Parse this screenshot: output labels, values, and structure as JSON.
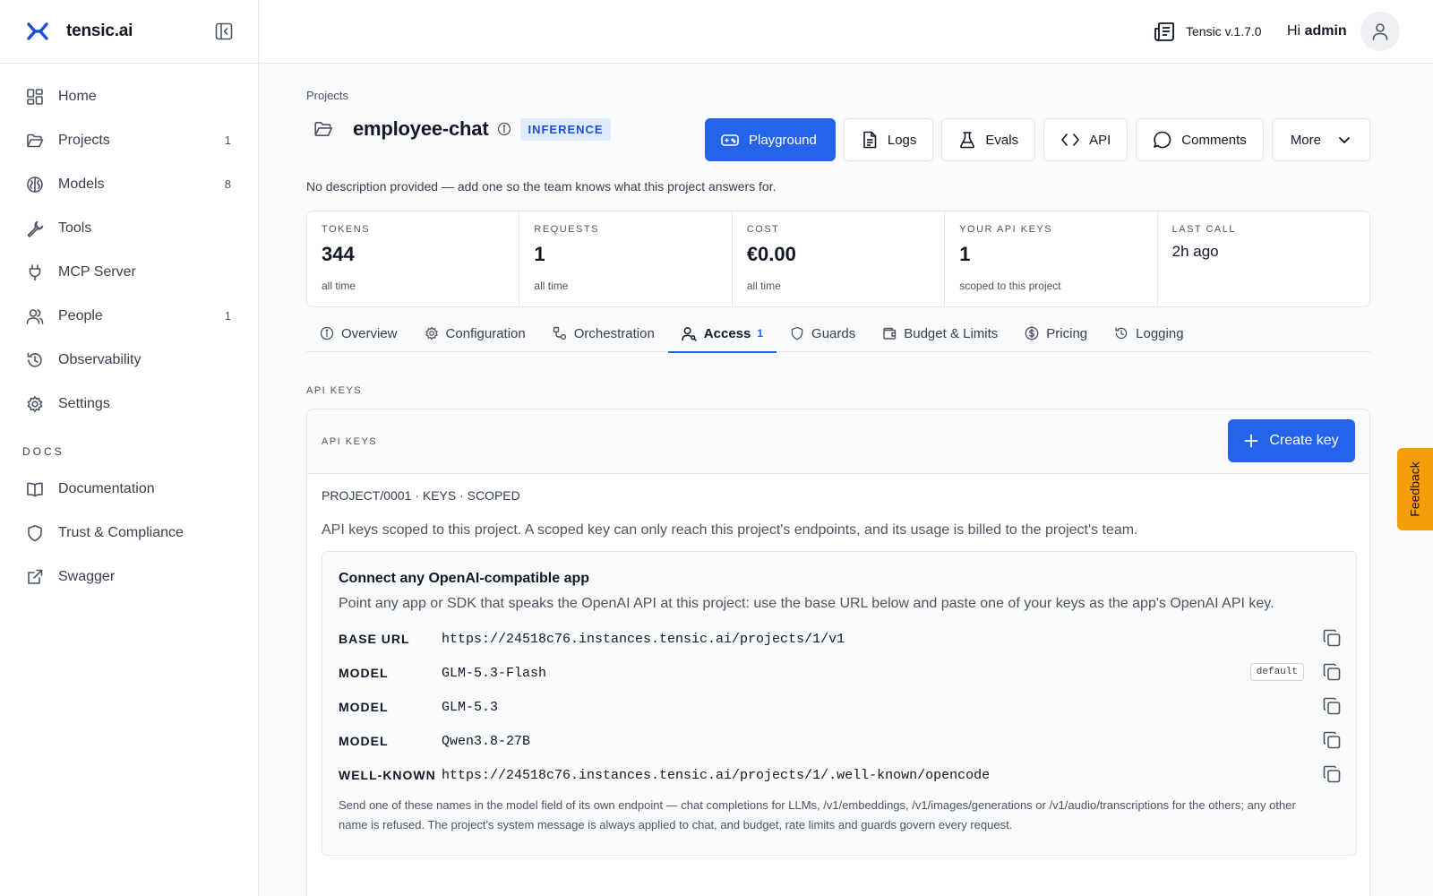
{
  "app": {
    "brand": "tensic.ai",
    "version": "Tensic v.1.7.0",
    "greeting_prefix": "Hi",
    "user": "admin",
    "accent": "#2563eb"
  },
  "sidebar": {
    "items": [
      {
        "label": "Home",
        "icon": "home-grid-icon",
        "count": ""
      },
      {
        "label": "Projects",
        "icon": "folder-icon",
        "count": "1"
      },
      {
        "label": "Models",
        "icon": "brain-icon",
        "count": "8"
      },
      {
        "label": "Tools",
        "icon": "wrench-icon",
        "count": ""
      },
      {
        "label": "MCP Server",
        "icon": "plug-icon",
        "count": ""
      },
      {
        "label": "People",
        "icon": "users-icon",
        "count": "1"
      },
      {
        "label": "Observability",
        "icon": "history-icon",
        "count": ""
      },
      {
        "label": "Settings",
        "icon": "gear-icon",
        "count": ""
      }
    ],
    "docs_heading": "DOCS",
    "docs": [
      {
        "label": "Documentation",
        "icon": "book-icon"
      },
      {
        "label": "Trust & Compliance",
        "icon": "shield-icon"
      },
      {
        "label": "Swagger",
        "icon": "external-link-icon"
      }
    ]
  },
  "project": {
    "breadcrumb": "Projects",
    "name": "employee-chat",
    "kind": "INFERENCE",
    "description": "No description provided — add one so the team knows what this project answers for."
  },
  "actions": {
    "playground": "Playground",
    "logs": "Logs",
    "evals": "Evals",
    "api": "API",
    "comments": "Comments",
    "more": "More"
  },
  "stats": [
    {
      "label": "TOKENS",
      "value": "344",
      "sub": "all time"
    },
    {
      "label": "REQUESTS",
      "value": "1",
      "sub": "all time"
    },
    {
      "label": "COST",
      "value": "€0.00",
      "sub": "all time"
    },
    {
      "label": "YOUR API KEYS",
      "value": "1",
      "sub": "scoped to this project"
    },
    {
      "label": "LAST CALL",
      "value": "2h ago",
      "sub": ""
    }
  ],
  "tabs": [
    {
      "label": "Overview",
      "icon": "info-icon"
    },
    {
      "label": "Configuration",
      "icon": "gear-icon"
    },
    {
      "label": "Orchestration",
      "icon": "route-icon"
    },
    {
      "label": "Access",
      "icon": "user-key-icon",
      "count": "1",
      "active": true
    },
    {
      "label": "Guards",
      "icon": "shield-icon"
    },
    {
      "label": "Budget & Limits",
      "icon": "wallet-icon"
    },
    {
      "label": "Pricing",
      "icon": "dollar-icon"
    },
    {
      "label": "Logging",
      "icon": "history-icon"
    }
  ],
  "api_keys": {
    "section_label": "API KEYS",
    "card_label": "API KEYS",
    "create_label": "Create key",
    "scope_line": "PROJECT/0001 · KEYS · SCOPED",
    "scope_desc": "API keys scoped to this project. A scoped key can only reach this project's endpoints, and its usage is billed to the project's team."
  },
  "connect": {
    "title": "Connect any OpenAI-compatible app",
    "desc": "Point any app or SDK that speaks the OpenAI API at this project: use the base URL below and paste one of your keys as the app's OpenAI API key.",
    "rows": [
      {
        "key": "BASE URL",
        "value": "https://24518c76.instances.tensic.ai/projects/1/v1",
        "badge": ""
      },
      {
        "key": "MODEL",
        "value": "GLM-5.3-Flash",
        "badge": "default"
      },
      {
        "key": "MODEL",
        "value": "GLM-5.3",
        "badge": ""
      },
      {
        "key": "MODEL",
        "value": "Qwen3.8-27B",
        "badge": ""
      },
      {
        "key": "WELL-KNOWN",
        "value": "https://24518c76.instances.tensic.ai/projects/1/.well-known/opencode",
        "badge": ""
      }
    ],
    "note": "Send one of these names in the model field of its own endpoint — chat completions for LLMs, /v1/embeddings, /v1/images/generations or /v1/audio/transcriptions for the others; any other name is refused. The project's system message is always applied to chat, and budget, rate limits and guards govern every request."
  },
  "feedback": "Feedback"
}
